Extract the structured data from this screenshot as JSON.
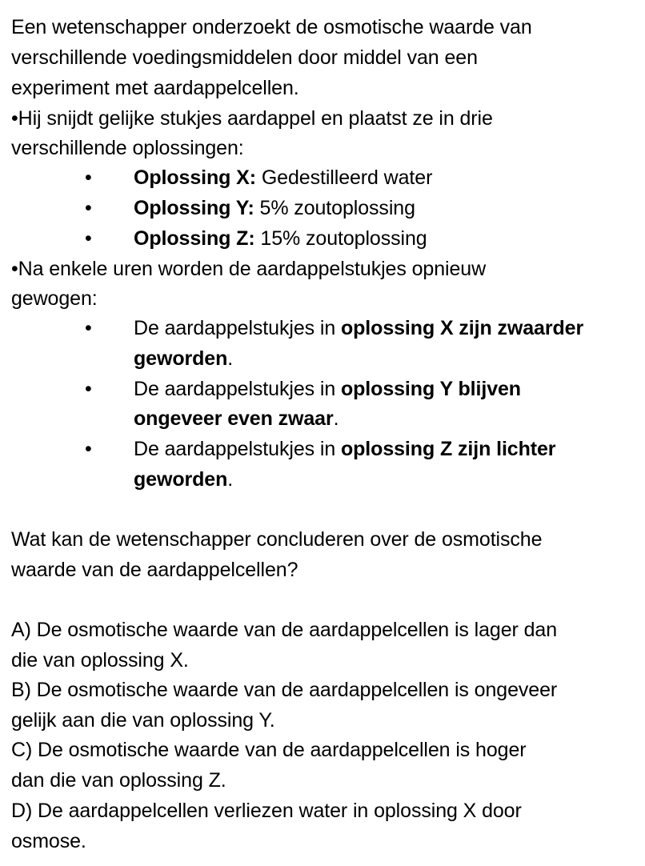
{
  "intro": {
    "line1": "Een wetenschapper onderzoekt de osmotische waarde van",
    "line2": "verschillende voedingsmiddelen door middel van een",
    "line3": "experiment met aardappelcellen."
  },
  "step1": {
    "line1": "•Hij snijdt gelijke stukjes aardappel en plaatst ze in drie",
    "line2": "verschillende oplossingen:"
  },
  "bullet_char": "•",
  "solutions": [
    {
      "label": "Oplossing X:",
      "text": " Gedestilleerd water"
    },
    {
      "label": "Oplossing Y:",
      "text": " 5% zoutoplossing"
    },
    {
      "label": "Oplossing Z:",
      "text": " 15% zoutoplossing"
    }
  ],
  "step2": {
    "line1": "•Na enkele uren worden de aardappelstukjes opnieuw",
    "line2": "gewogen:"
  },
  "results": [
    {
      "prefix": "De aardappelstukjes in ",
      "bold1": "oplossing X zijn zwaarder",
      "bold2": "geworden",
      "suffix": "."
    },
    {
      "prefix": "De aardappelstukjes in ",
      "bold1": "oplossing Y blijven",
      "bold2": "ongeveer even zwaar",
      "suffix": "."
    },
    {
      "prefix": "De aardappelstukjes in ",
      "bold1": "oplossing Z zijn lichter",
      "bold2": "geworden",
      "suffix": "."
    }
  ],
  "question": {
    "line1": "Wat kan de wetenschapper concluderen over de osmotische",
    "line2": "waarde van de aardappelcellen?"
  },
  "options": [
    {
      "line1": "A) De osmotische waarde van de aardappelcellen is lager dan",
      "line2": "die van oplossing X."
    },
    {
      "line1": "B) De osmotische waarde van de aardappelcellen is ongeveer",
      "line2": "gelijk aan die van oplossing Y."
    },
    {
      "line1": "C) De osmotische waarde van de aardappelcellen is hoger",
      "line2": "dan die van oplossing Z."
    },
    {
      "line1": "D) De aardappelcellen verliezen water in oplossing X door",
      "line2": "osmose."
    }
  ]
}
